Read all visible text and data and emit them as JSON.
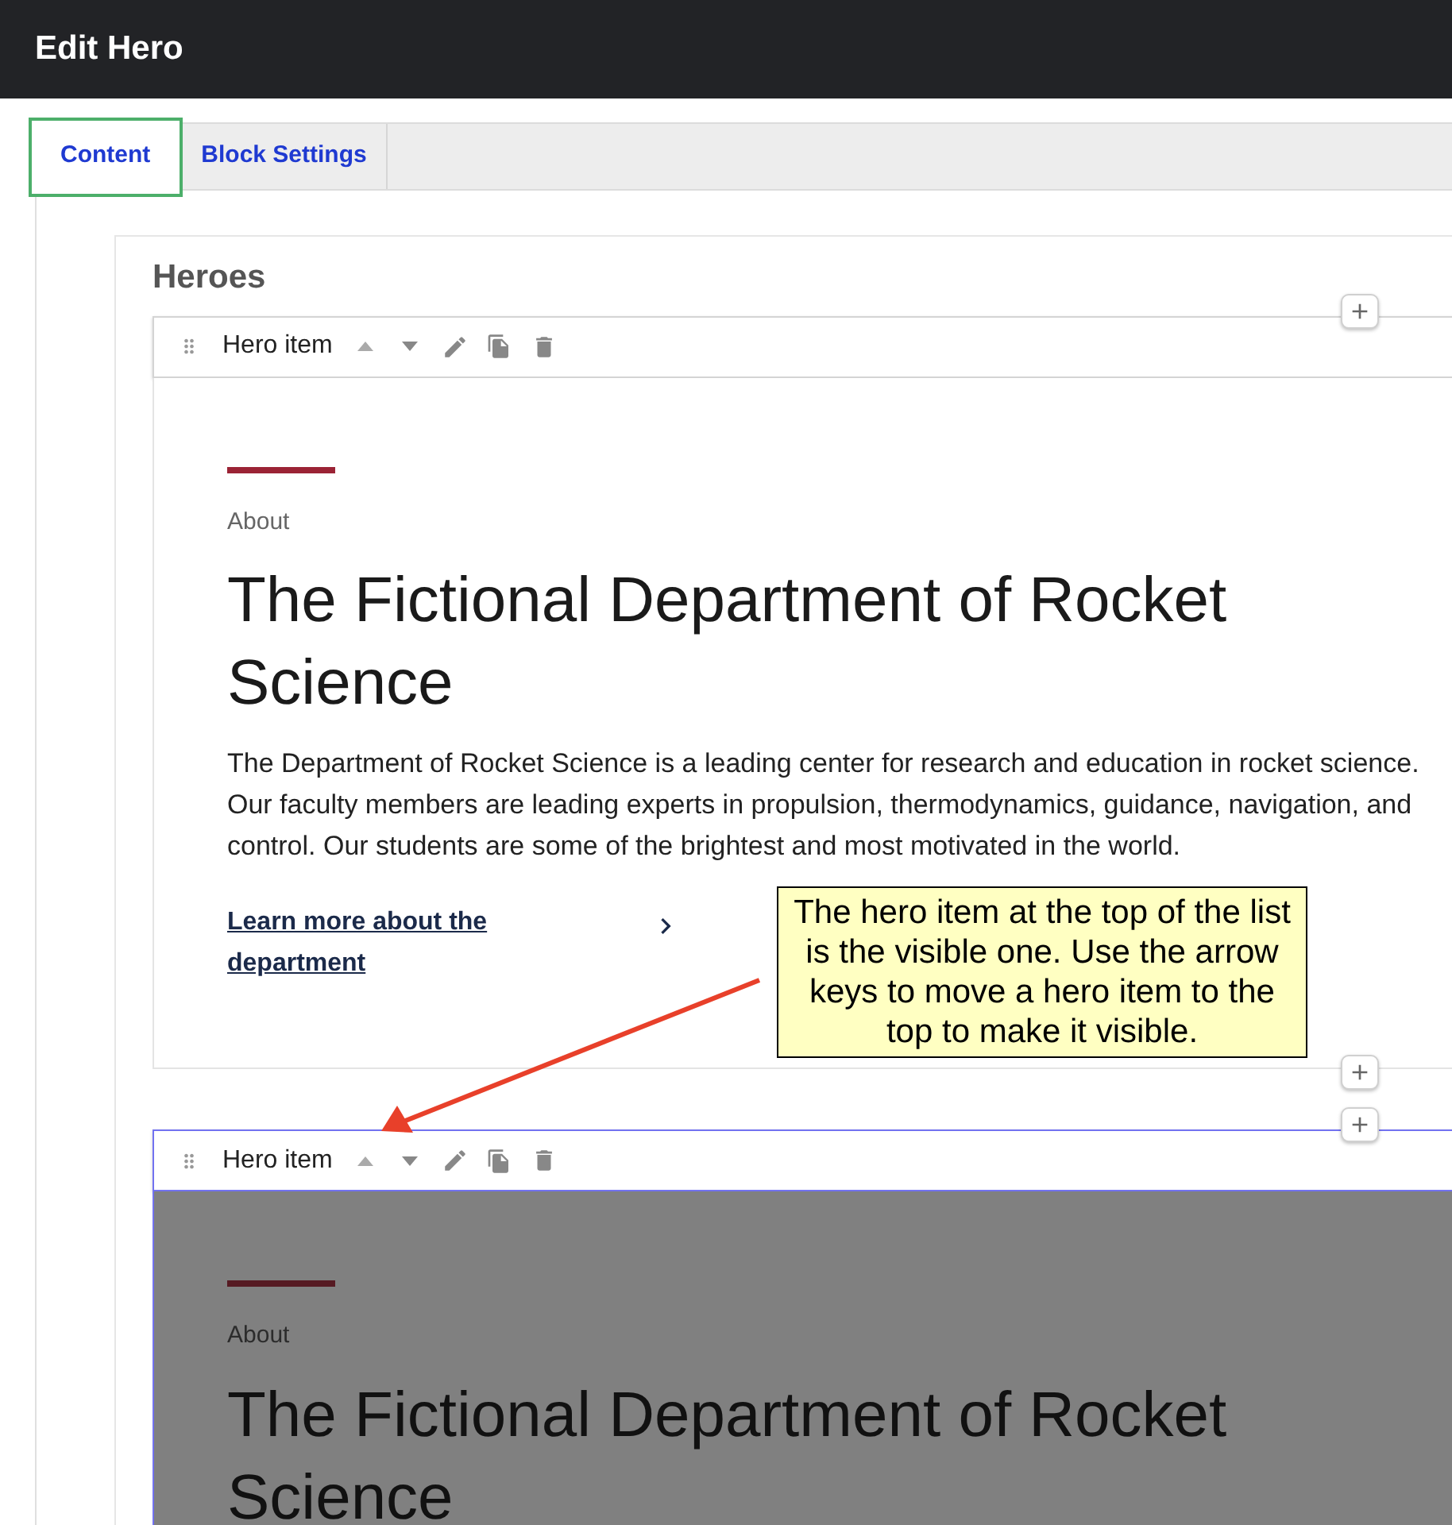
{
  "window": {
    "title": "Edit Hero"
  },
  "tabs": [
    {
      "label": "Content",
      "selected": true
    },
    {
      "label": "Block Settings",
      "selected": false
    }
  ],
  "section": {
    "title": "Heroes"
  },
  "hero_items": [
    {
      "label": "Hero item",
      "selected": false,
      "eyebrow": "About",
      "heading": "The Fictional Department of Rocket Science",
      "body": "The Department of Rocket Science is a leading center for research and education in rocket science. Our faculty members are leading experts in propulsion, thermodynamics, guidance, navigation, and control. Our students are some of the brightest and most motivated in the world.",
      "link": "Learn more about the department"
    },
    {
      "label": "Hero item",
      "selected": true,
      "eyebrow": "About",
      "heading": "The Fictional Department of Rocket Science"
    }
  ],
  "callout": {
    "text": "The hero item at the top of the list is the visible one. Use the arrow keys to move a hero item to the top to make it visible."
  }
}
